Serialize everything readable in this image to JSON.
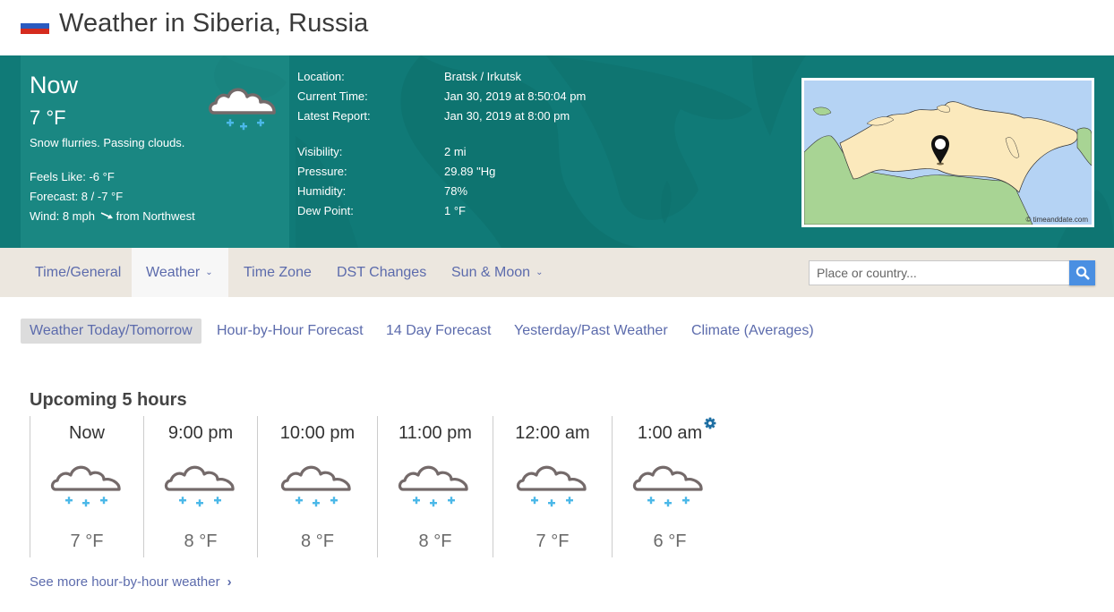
{
  "header": {
    "title": "Weather in Siberia, Russia",
    "flag_icon": "russia-flag-icon"
  },
  "now": {
    "label": "Now",
    "temperature": "7 °F",
    "description": "Snow flurries. Passing clouds.",
    "feels_like": "Feels Like: -6 °F",
    "forecast": "Forecast: 8 / -7 °F",
    "wind_prefix": "Wind: 8 mph",
    "wind_suffix": "from Northwest",
    "icon": "snow-cloud-icon"
  },
  "details": [
    {
      "label": "Location:",
      "value": "Bratsk / Irkutsk"
    },
    {
      "label": "Current Time:",
      "value": "Jan 30, 2019 at 8:50:04 pm"
    },
    {
      "label": "Latest Report:",
      "value": "Jan 30, 2019 at 8:00 pm"
    },
    {
      "label": "Visibility:",
      "value": "2 mi"
    },
    {
      "label": "Pressure:",
      "value": "29.89 \"Hg"
    },
    {
      "label": "Humidity:",
      "value": "78%"
    },
    {
      "label": "Dew Point:",
      "value": "1 °F"
    }
  ],
  "map": {
    "credit": "© timeanddate.com",
    "colors": {
      "sea": "#b5d3f4",
      "russia": "#fbe9bc",
      "neighbors": "#a8d494"
    }
  },
  "nav": {
    "items": [
      {
        "label": "Time/General",
        "dropdown": false,
        "active": false
      },
      {
        "label": "Weather",
        "dropdown": true,
        "active": true
      },
      {
        "label": "Time Zone",
        "dropdown": false,
        "active": false
      },
      {
        "label": "DST Changes",
        "dropdown": false,
        "active": false
      },
      {
        "label": "Sun & Moon",
        "dropdown": true,
        "active": false
      }
    ],
    "search_placeholder": "Place or country...",
    "search_value": ""
  },
  "subnav": {
    "items": [
      {
        "label": "Weather Today/Tomorrow",
        "active": true
      },
      {
        "label": "Hour-by-Hour Forecast",
        "active": false
      },
      {
        "label": "14 Day Forecast",
        "active": false
      },
      {
        "label": "Yesterday/Past Weather",
        "active": false
      },
      {
        "label": "Climate (Averages)",
        "active": false
      }
    ]
  },
  "upcoming": {
    "title": "Upcoming 5 hours",
    "hours": [
      {
        "time": "Now",
        "temp": "7 °F",
        "icon": "snow-cloud-icon"
      },
      {
        "time": "9:00 pm",
        "temp": "8 °F",
        "icon": "snow-cloud-icon"
      },
      {
        "time": "10:00 pm",
        "temp": "8 °F",
        "icon": "snow-cloud-icon"
      },
      {
        "time": "11:00 pm",
        "temp": "8 °F",
        "icon": "snow-cloud-icon"
      },
      {
        "time": "12:00 am",
        "temp": "7 °F",
        "icon": "snow-cloud-icon"
      },
      {
        "time": "1:00 am",
        "temp": "6 °F",
        "icon": "snow-cloud-icon"
      }
    ],
    "more_link": "See more hour-by-hour weather"
  },
  "colors": {
    "banner": "#107a77",
    "nav_bg": "#ece7df",
    "link": "#5c6bac",
    "search_button": "#4a8fe2",
    "snow": "#4bb8e8",
    "cloud_outline": "#736868"
  }
}
